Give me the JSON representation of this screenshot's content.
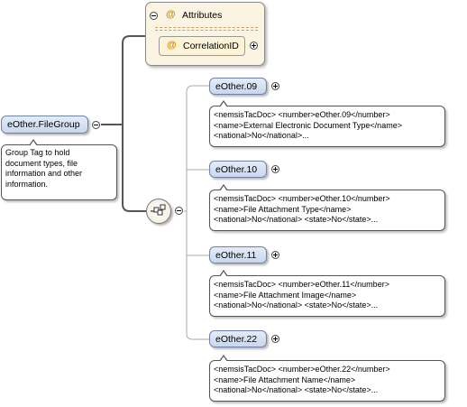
{
  "root": {
    "label": "eOther.FileGroup",
    "note": [
      "Group Tag to hold",
      "document types, file",
      "information and other",
      "information."
    ]
  },
  "attributes": {
    "title": "Attributes",
    "items": [
      "CorrelationID"
    ],
    "at_symbol": "@"
  },
  "elements": [
    {
      "label": "eOther.09",
      "note": [
        "<nemsisTacDoc> <number>eOther.09</number>",
        "<name>External Electronic Document Type</name>",
        "<national>No</national>..."
      ]
    },
    {
      "label": "eOther.10",
      "note": [
        "<nemsisTacDoc> <number>eOther.10</number>",
        "<name>File Attachment Type</name>",
        "<national>No</national> <state>No</state>..."
      ]
    },
    {
      "label": "eOther.11",
      "note": [
        "<nemsisTacDoc> <number>eOther.11</number>",
        "<name>File Attachment Image</name>",
        "<national>No</national> <state>No</state>..."
      ]
    },
    {
      "label": "eOther.22",
      "note": [
        "<nemsisTacDoc> <number>eOther.22</number>",
        "<name>File Attachment Name</name>",
        "<national>No</national> <state>No</state>..."
      ]
    }
  ],
  "icons": {
    "collapse": "minus-circle-icon",
    "expand": "plus-circle-icon",
    "sequence": "sequence-compositor-icon",
    "attribute": "attribute-at-icon"
  }
}
